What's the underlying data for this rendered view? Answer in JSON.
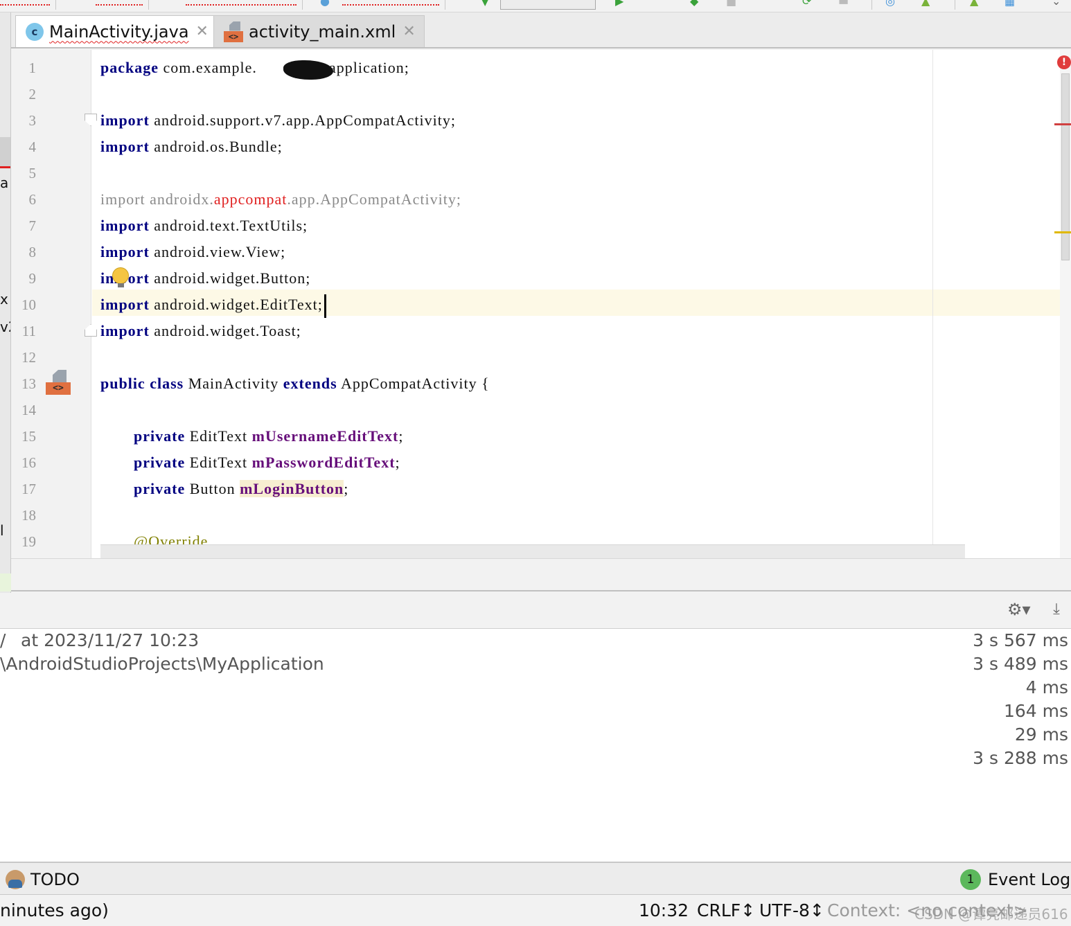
{
  "toolbar": {
    "breadcrumb_icons": [
      "run-icon",
      "debug-icon",
      "sync-icon",
      "avd-icon",
      "sdk-icon"
    ]
  },
  "left_strip": {
    "chars": [
      "a",
      "x",
      "v2",
      "l"
    ]
  },
  "tabs": [
    {
      "label": "MainActivity.java",
      "icon": "java-class-icon",
      "active": true
    },
    {
      "label": "activity_main.xml",
      "icon": "xml-layout-icon",
      "active": false
    }
  ],
  "editor": {
    "line_numbers": [
      "1",
      "2",
      "3",
      "4",
      "5",
      "6",
      "7",
      "8",
      "9",
      "10",
      "11",
      "12",
      "13",
      "14",
      "15",
      "16",
      "17",
      "18",
      "19"
    ],
    "lines": [
      {
        "kw": "package",
        "rest_a": " com.example.",
        "rest_b": "myapplication;"
      },
      {
        "text": ""
      },
      {
        "kw": "import",
        "rest": " android.support.v7.app.AppCompatActivity;"
      },
      {
        "kw": "import",
        "rest": " android.os.Bundle;"
      },
      {
        "text": ""
      },
      {
        "kw": "import",
        "a": " androidx.",
        "red": "appcompat",
        "b": ".app.AppCompatActivity;"
      },
      {
        "kw": "import",
        "rest": " android.text.TextUtils;"
      },
      {
        "kw": "import",
        "rest": " android.view.View;"
      },
      {
        "kw": "import",
        "rest": " android.widget.Button;"
      },
      {
        "kw": "import",
        "rest": " android.widget.EditText;"
      },
      {
        "kw": "import",
        "rest": " android.widget.Toast;"
      },
      {
        "text": ""
      },
      {
        "kw1": "public",
        "kw2": "class",
        "name": "MainActivity",
        "kw3": "extends",
        "rest": "AppCompatActivity {"
      },
      {
        "text": ""
      },
      {
        "kw": "private",
        "type": "EditText",
        "field": "mUsernameEditText",
        "end": ";"
      },
      {
        "kw": "private",
        "type": "EditText",
        "field": "mPasswordEditText",
        "end": ";"
      },
      {
        "kw": "private",
        "type": "Button",
        "field": "mLoginButton",
        "end": ";"
      },
      {
        "text": ""
      },
      {
        "annotation": "@Override"
      }
    ],
    "current_line": "10"
  },
  "build_panel": {
    "lines": [
      "at 2023/11/27 10:23",
      "\\AndroidStudioProjects\\MyApplication"
    ],
    "first_prefix": "/",
    "timings": [
      "3 s 567 ms",
      "3 s 489 ms",
      "4 ms",
      "164 ms",
      "29 ms",
      "3 s 288 ms"
    ]
  },
  "tool_windows": {
    "todo": "TODO",
    "event_log": "Event Log",
    "event_count": "1"
  },
  "status_bar": {
    "message": "ninutes ago)",
    "position": "10:32",
    "line_sep": "CRLF↕",
    "encoding": "UTF-8↕",
    "context": "Context: <no context>"
  },
  "watermark": "CSDN @谭亮邮递员616",
  "colors": {
    "keyword": "#000080",
    "field": "#660e7a",
    "error": "#e02020",
    "annotation": "#808000",
    "caret_row": "#fdf9e6"
  }
}
